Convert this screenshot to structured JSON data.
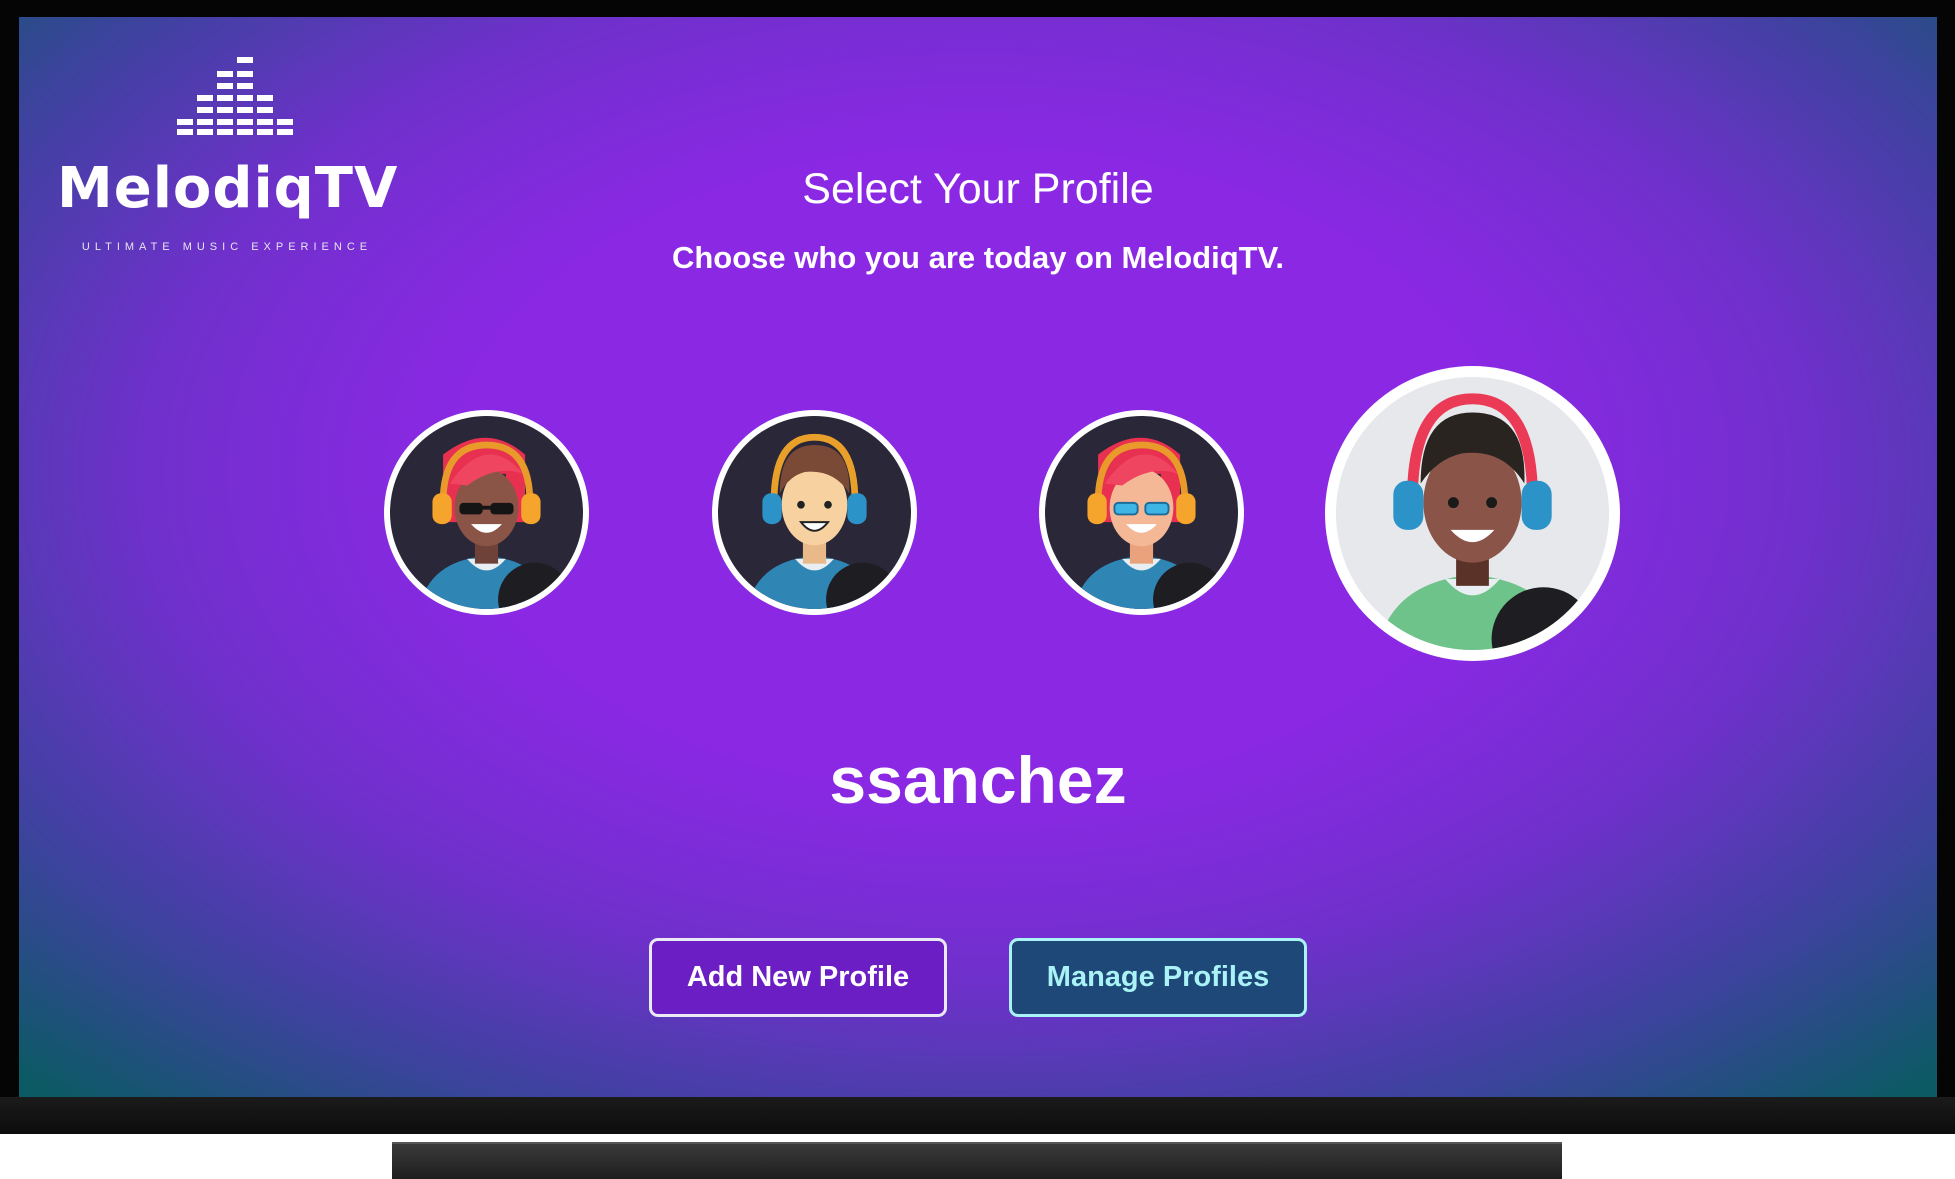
{
  "app": {
    "brand_name": "MelodiqTV",
    "tagline": "ULTIMATE MUSIC EXPERIENCE"
  },
  "header": {
    "title": "Select Your Profile",
    "subtitle": "Choose who you are today on MelodiqTV."
  },
  "profiles": [
    {
      "avatar": "woman-red-hair-sunglasses-headphones",
      "selected": false
    },
    {
      "avatar": "man-brown-hair-blue-headphones",
      "selected": false
    },
    {
      "avatar": "woman-red-hair-blue-glasses-headphones",
      "selected": false
    },
    {
      "avatar": "man-dark-skin-red-blue-headphones",
      "selected": true
    }
  ],
  "selected_profile": {
    "username": "ssanchez"
  },
  "actions": {
    "add_label": "Add New Profile",
    "manage_label": "Manage Profiles"
  },
  "colors": {
    "background_center": "#8a28e4",
    "background_edge": "#0b5a64",
    "add_button_bg": "#6a1ec4",
    "manage_button_bg": "#1d4878",
    "manage_button_text": "#a9f2f6"
  }
}
